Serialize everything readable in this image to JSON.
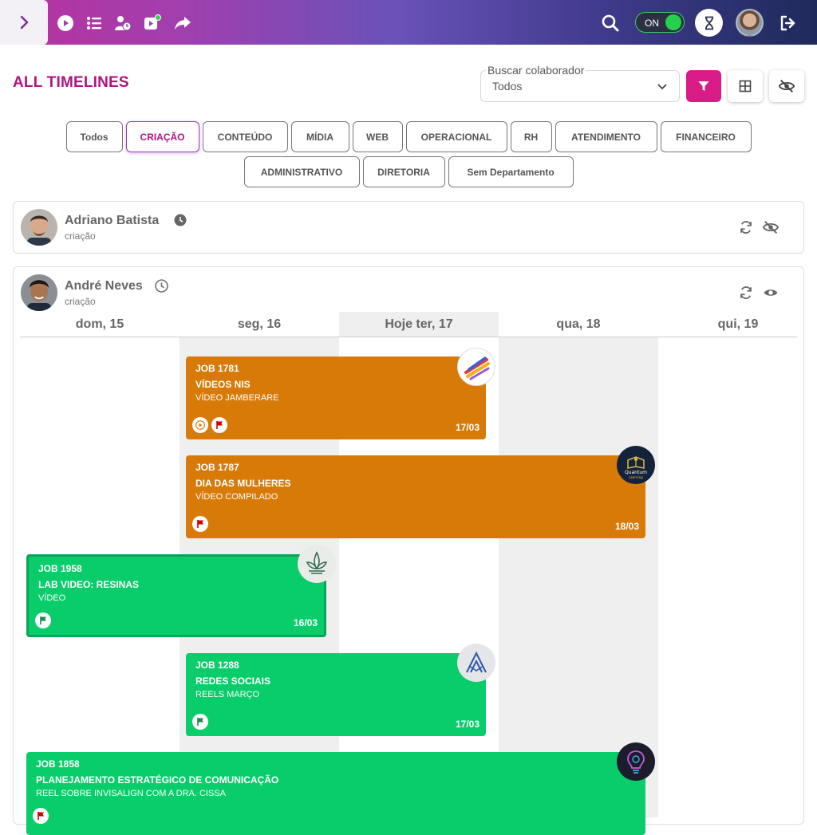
{
  "topbar": {
    "toggle_state": "ON",
    "icons": [
      "chevron-right-icon",
      "play-icon",
      "task-list-icon",
      "user-clock-icon",
      "video-icon",
      "share-icon",
      "search-icon",
      "hourglass-icon",
      "logout-icon"
    ]
  },
  "header": {
    "title": "ALL TIMELINES",
    "filter_label": "Buscar colaborador",
    "filter_value": "Todos"
  },
  "departments": {
    "row1": [
      "Todos",
      "CRIAÇÃO",
      "CONTEÚDO",
      "MÍDIA",
      "WEB",
      "OPERACIONAL",
      "RH",
      "ATENDIMENTO",
      "FINANCEIRO"
    ],
    "row2": [
      "ADMINISTRATIVO",
      "DIRETORIA",
      "Sem Departamento"
    ],
    "active": "CRIAÇÃO"
  },
  "people": [
    {
      "name": "Adriano Batista",
      "dept": "criação"
    },
    {
      "name": "André Neves",
      "dept": "criação"
    }
  ],
  "days": [
    "dom, 15",
    "seg, 16",
    "Hoje ter, 17",
    "qua, 18",
    "qui, 19"
  ],
  "jobs": [
    {
      "num": "JOB 1781",
      "title": "VÍDEOS NIS",
      "sub": "VÍDEO JAMBERARE",
      "date": "17/03",
      "color": "#d77a08",
      "logo": "brush-strokes-logo"
    },
    {
      "num": "JOB 1787",
      "title": "DIA DAS MULHERES",
      "sub": "VÍDEO COMPILADO",
      "date": "18/03",
      "color": "#d77a08",
      "logo": "quantum-learning-logo",
      "logo_text": "Quantum Learning"
    },
    {
      "num": "JOB 1958",
      "title": "LAB VIDEO: RESINAS",
      "sub": "VÍDEO",
      "date": "16/03",
      "color": "#08cd6a",
      "logo": "lotus-logo"
    },
    {
      "num": "JOB 1288",
      "title": "REDES SOCIAIS",
      "sub": "REELS MARÇO",
      "date": "17/03",
      "color": "#08cd6a",
      "logo": "mountain-logo"
    },
    {
      "num": "JOB 1858",
      "title": "PLANEJAMENTO ESTRATÉGICO DE COMUNICAÇÃO",
      "sub": "REEL SOBRE INVISALIGN COM A DRA. CISSA",
      "date": "",
      "color": "#08cd6a",
      "logo": "lightbulb-logo"
    }
  ],
  "colors": {
    "accent": "#b0147e",
    "filter_button": "#d81b86",
    "orange_job": "#d77a08",
    "green_job": "#08cd6a",
    "toggle_on": "#25d04c"
  }
}
